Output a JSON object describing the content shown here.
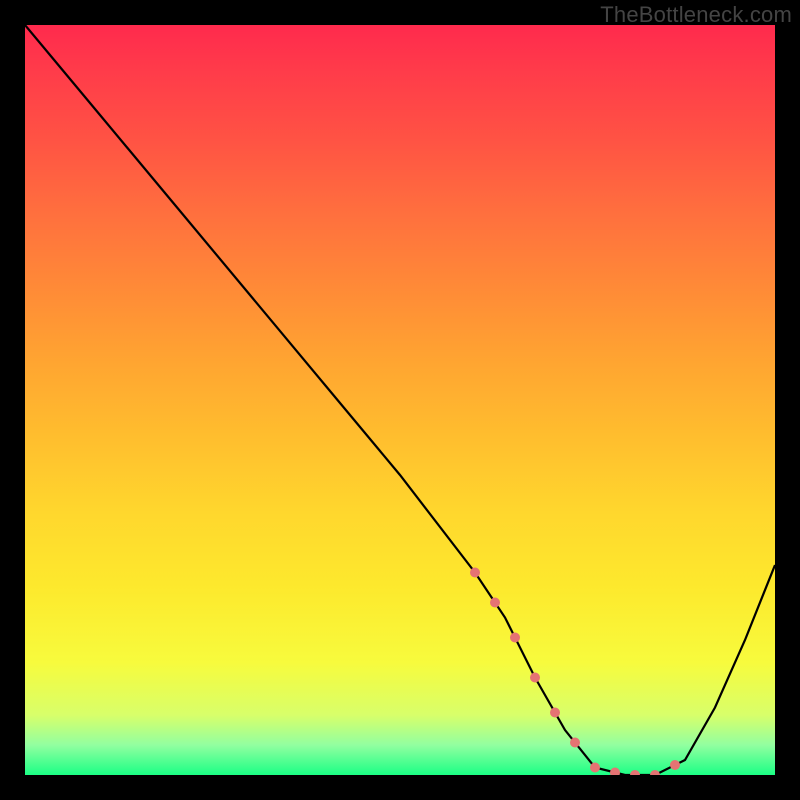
{
  "watermark": "TheBottleneck.com",
  "chart_data": {
    "type": "line",
    "title": "",
    "xlabel": "",
    "ylabel": "",
    "xlim": [
      0,
      100
    ],
    "ylim": [
      0,
      100
    ],
    "gradient_stops": [
      {
        "pct": 0,
        "color": "#ff2a4d"
      },
      {
        "pct": 6,
        "color": "#ff3b4a"
      },
      {
        "pct": 15,
        "color": "#ff5244"
      },
      {
        "pct": 25,
        "color": "#ff6f3e"
      },
      {
        "pct": 35,
        "color": "#ff8a37"
      },
      {
        "pct": 45,
        "color": "#ffa531"
      },
      {
        "pct": 55,
        "color": "#ffbe2e"
      },
      {
        "pct": 65,
        "color": "#ffd72d"
      },
      {
        "pct": 75,
        "color": "#fde92d"
      },
      {
        "pct": 85,
        "color": "#f7fb3d"
      },
      {
        "pct": 92,
        "color": "#d8ff6a"
      },
      {
        "pct": 96,
        "color": "#92ffa0"
      },
      {
        "pct": 100,
        "color": "#1bff85"
      }
    ],
    "series": [
      {
        "name": "main-curve",
        "color": "#000000",
        "x": [
          0,
          5,
          10,
          20,
          30,
          40,
          50,
          60,
          64,
          68,
          72,
          76,
          80,
          84,
          88,
          92,
          96,
          100
        ],
        "values": [
          100,
          94,
          88,
          76,
          64,
          52,
          40,
          27,
          21,
          13,
          6,
          1,
          0,
          0,
          2,
          9,
          18,
          28
        ]
      }
    ],
    "dotted_segment": {
      "name": "optimal-range",
      "color": "#e57373",
      "x": [
        60,
        64,
        68,
        72,
        76,
        80,
        84,
        88
      ],
      "values": [
        27,
        21,
        13,
        6,
        1,
        0,
        0,
        2
      ]
    }
  }
}
